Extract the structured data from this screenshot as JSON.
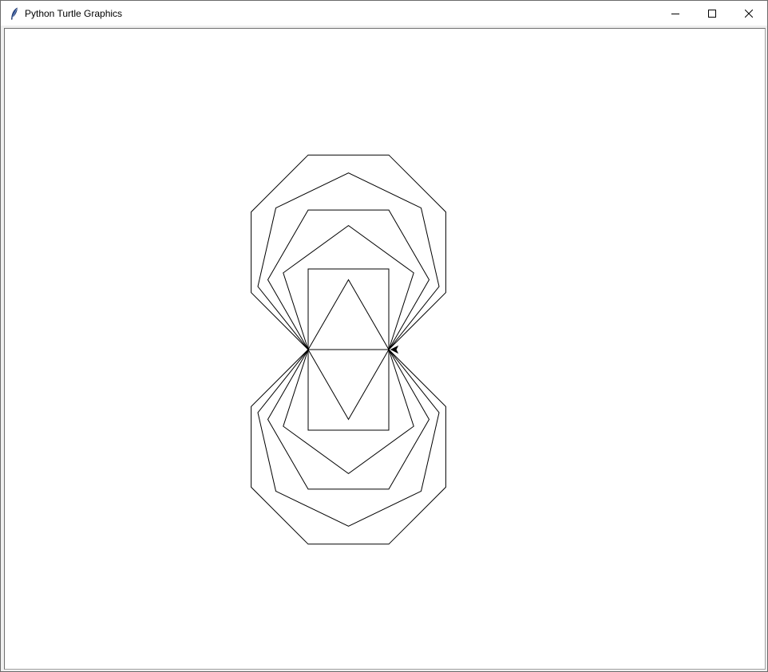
{
  "window": {
    "title": "Python Turtle Graphics",
    "icon": "feather-icon",
    "controls": [
      "minimize-icon",
      "maximize-icon",
      "close-icon"
    ]
  },
  "canvas": {
    "background": "#ffffff",
    "stroke": "#000000",
    "turtle_icon": "arrow-cursor-icon"
  }
}
